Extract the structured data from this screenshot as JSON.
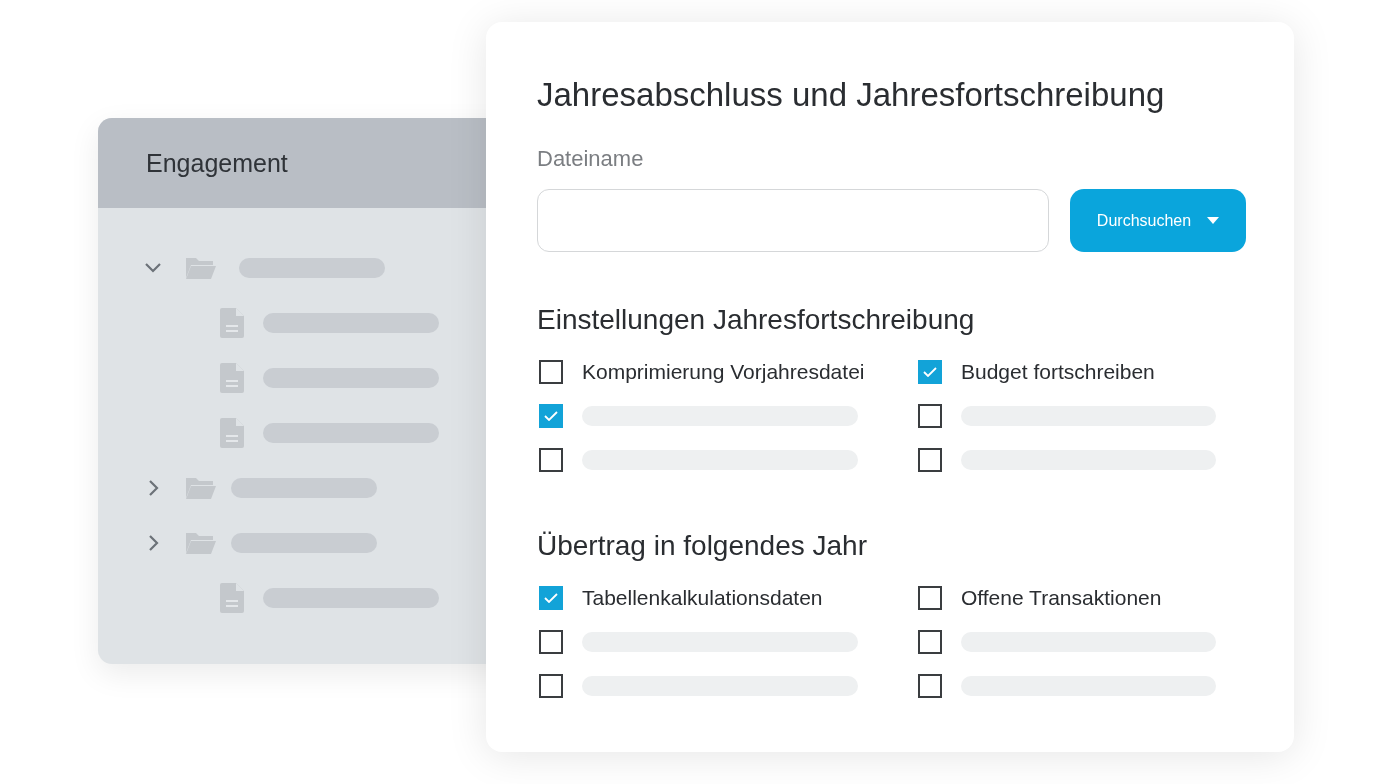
{
  "side_panel": {
    "title": "Engagement",
    "tree": [
      {
        "kind": "folder",
        "expanded": true,
        "children": [
          {
            "kind": "file"
          },
          {
            "kind": "file"
          },
          {
            "kind": "file"
          }
        ]
      },
      {
        "kind": "folder",
        "expanded": false
      },
      {
        "kind": "folder",
        "expanded": false,
        "children": [
          {
            "kind": "file"
          }
        ]
      }
    ]
  },
  "dialog": {
    "title": "Jahresabschluss und Jahresfortschreibung",
    "file_label": "Dateiname",
    "browse_button": "Durchsuchen",
    "sections": [
      {
        "title": "Einstellungen Jahresfortschreibung",
        "options": [
          {
            "kind": "text",
            "label": "Komprimierung Vorjahresdatei",
            "checked": false
          },
          {
            "kind": "text",
            "label": "Budget fortschreiben",
            "checked": true
          },
          {
            "kind": "skeleton",
            "checked": true
          },
          {
            "kind": "skeleton",
            "checked": false
          },
          {
            "kind": "skeleton",
            "checked": false
          },
          {
            "kind": "skeleton",
            "checked": false
          }
        ]
      },
      {
        "title": "Übertrag in folgendes Jahr",
        "options": [
          {
            "kind": "text",
            "label": "Tabellenkalkulationsdaten",
            "checked": true
          },
          {
            "kind": "text",
            "label": "Offene Transaktionen",
            "checked": false
          },
          {
            "kind": "skeleton",
            "checked": false
          },
          {
            "kind": "skeleton",
            "checked": false
          },
          {
            "kind": "skeleton",
            "checked": false
          },
          {
            "kind": "skeleton",
            "checked": false
          }
        ]
      }
    ]
  }
}
